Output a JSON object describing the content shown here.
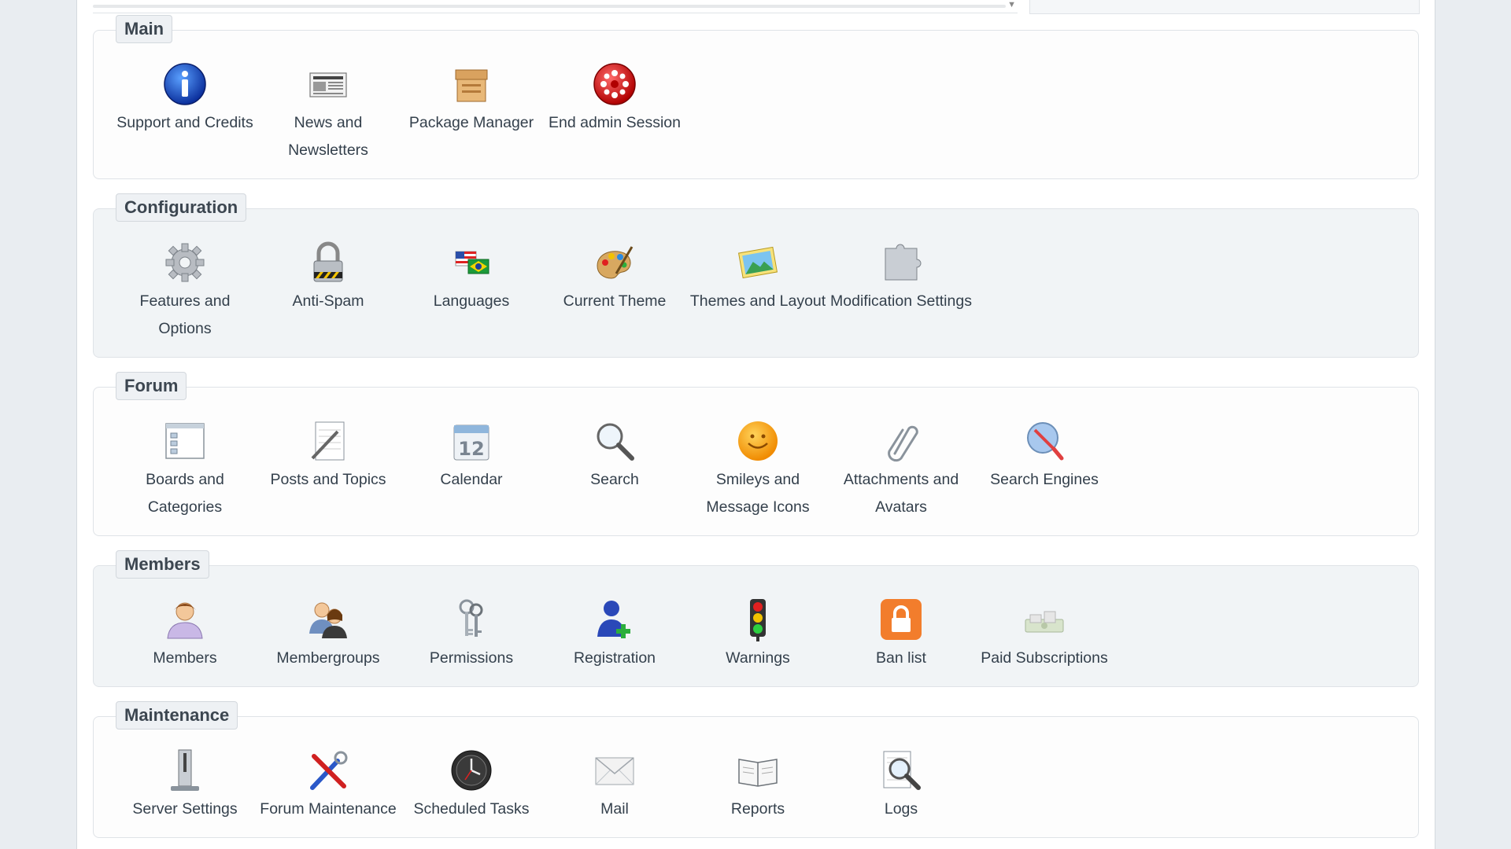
{
  "sections": [
    {
      "title": "Main",
      "items": [
        {
          "label": "Support and Credits",
          "icon": "info-icon"
        },
        {
          "label": "News and Newsletters",
          "icon": "newspaper-icon"
        },
        {
          "label": "Package Manager",
          "icon": "package-icon"
        },
        {
          "label": "End admin Session",
          "icon": "end-session-icon"
        }
      ]
    },
    {
      "title": "Configuration",
      "items": [
        {
          "label": "Features and Options",
          "icon": "gear-icon"
        },
        {
          "label": "Anti-Spam",
          "icon": "padlock-icon"
        },
        {
          "label": "Languages",
          "icon": "flags-icon"
        },
        {
          "label": "Current Theme",
          "icon": "palette-icon"
        },
        {
          "label": "Themes and Layout",
          "icon": "picture-icon"
        },
        {
          "label": "Modification Settings",
          "icon": "puzzle-icon"
        }
      ]
    },
    {
      "title": "Forum",
      "items": [
        {
          "label": "Boards and Categories",
          "icon": "boards-icon"
        },
        {
          "label": "Posts and Topics",
          "icon": "pencil-page-icon"
        },
        {
          "label": "Calendar",
          "icon": "calendar-icon"
        },
        {
          "label": "Search",
          "icon": "magnifier-icon"
        },
        {
          "label": "Smileys and Message Icons",
          "icon": "smiley-icon"
        },
        {
          "label": "Attachments and Avatars",
          "icon": "paperclip-icon"
        },
        {
          "label": "Search Engines",
          "icon": "search-engines-icon"
        }
      ]
    },
    {
      "title": "Members",
      "items": [
        {
          "label": "Members",
          "icon": "member-icon"
        },
        {
          "label": "Membergroups",
          "icon": "membergroups-icon"
        },
        {
          "label": "Permissions",
          "icon": "keys-icon"
        },
        {
          "label": "Registration",
          "icon": "add-user-icon"
        },
        {
          "label": "Warnings",
          "icon": "traffic-light-icon"
        },
        {
          "label": "Ban list",
          "icon": "ban-lock-icon"
        },
        {
          "label": "Paid Subscriptions",
          "icon": "money-icon"
        }
      ]
    },
    {
      "title": "Maintenance",
      "items": [
        {
          "label": "Server Settings",
          "icon": "server-icon"
        },
        {
          "label": "Forum Maintenance",
          "icon": "tools-icon"
        },
        {
          "label": "Scheduled Tasks",
          "icon": "clock-icon"
        },
        {
          "label": "Mail",
          "icon": "envelope-icon"
        },
        {
          "label": "Reports",
          "icon": "book-icon"
        },
        {
          "label": "Logs",
          "icon": "logs-magnifier-icon"
        }
      ]
    }
  ],
  "calendar_day": "12"
}
